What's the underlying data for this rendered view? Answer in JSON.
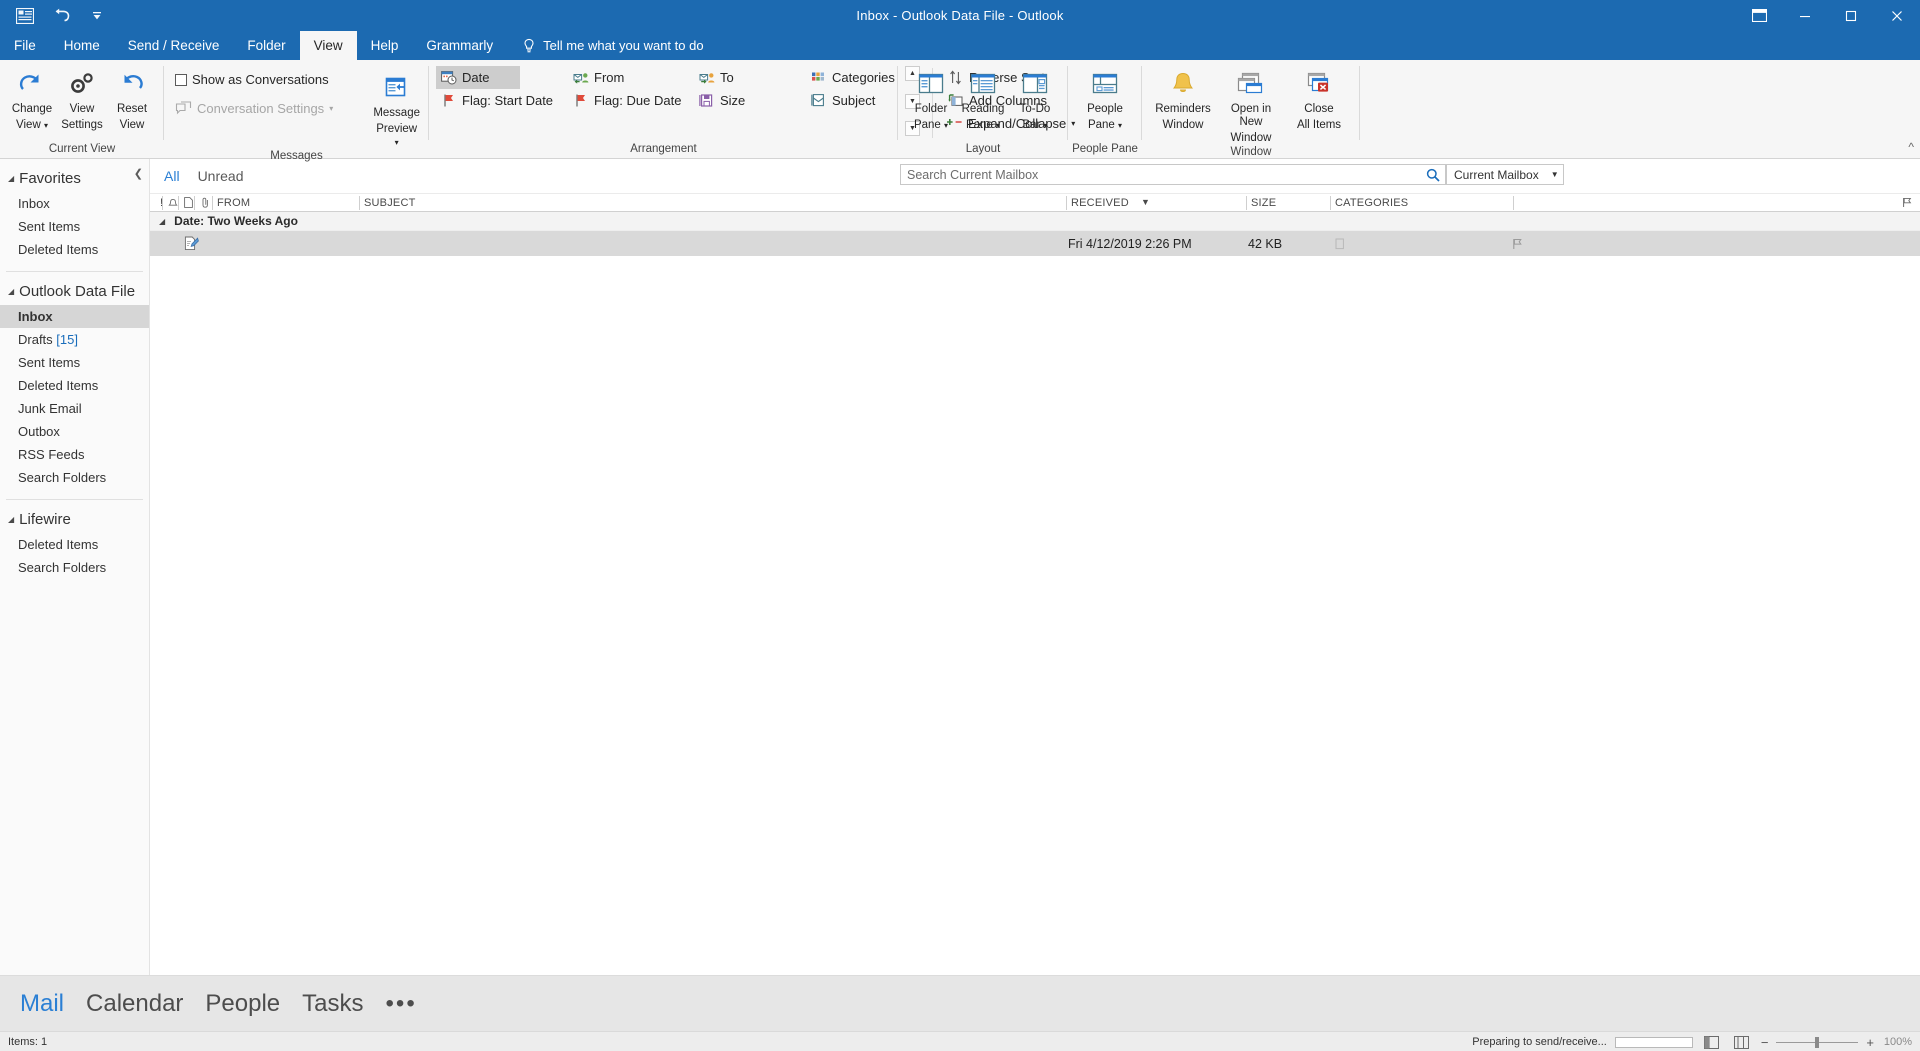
{
  "titlebar": {
    "title": "Inbox - Outlook Data File  -  Outlook",
    "qat": [
      {
        "name": "quick-access-app-icon",
        "glyph": "app"
      },
      {
        "name": "undo-icon",
        "glyph": "undo"
      },
      {
        "name": "customize-quick-access-toolbar-icon",
        "glyph": "caret"
      }
    ],
    "ribbon_display_options": "ribbon-display-options-icon",
    "minimize": "minimize-icon",
    "maximize": "maximize-icon",
    "close": "close-icon"
  },
  "tabs": [
    {
      "label": "File",
      "active": false
    },
    {
      "label": "Home",
      "active": false
    },
    {
      "label": "Send / Receive",
      "active": false
    },
    {
      "label": "Folder",
      "active": false
    },
    {
      "label": "View",
      "active": true
    },
    {
      "label": "Help",
      "active": false
    },
    {
      "label": "Grammarly",
      "active": false
    }
  ],
  "tell_me": "Tell me what you want to do",
  "ribbon": {
    "groups": [
      {
        "label": "Current View",
        "buttons": [
          {
            "label_line1": "Change",
            "label_line2": "View",
            "has_caret": true,
            "icon": "change-view-icon"
          },
          {
            "label_line1": "View",
            "label_line2": "Settings",
            "has_caret": false,
            "icon": "view-settings-icon"
          },
          {
            "label_line1": "Reset",
            "label_line2": "View",
            "has_caret": false,
            "icon": "reset-view-icon"
          }
        ]
      },
      {
        "label": "Messages",
        "checkbox_label": "Show as Conversations",
        "checkbox_checked": false,
        "conversation_settings_label": "Conversation Settings",
        "conversation_settings_disabled": true,
        "message_preview": {
          "label_line1": "Message",
          "label_line2": "Preview",
          "has_caret": true
        }
      },
      {
        "label": "Arrangement",
        "items": [
          {
            "label": "Date",
            "selected": true,
            "icon": "date-arrangement-icon"
          },
          {
            "label": "From",
            "selected": false,
            "icon": "from-arrangement-icon"
          },
          {
            "label": "To",
            "selected": false,
            "icon": "to-arrangement-icon"
          },
          {
            "label": "Categories",
            "selected": false,
            "icon": "categories-arrangement-icon"
          },
          {
            "label": "Flag: Start Date",
            "selected": false,
            "icon": "flag-start-date-icon"
          },
          {
            "label": "Flag: Due Date",
            "selected": false,
            "icon": "flag-due-date-icon"
          },
          {
            "label": "Size",
            "selected": false,
            "icon": "size-arrangement-icon"
          },
          {
            "label": "Subject",
            "selected": false,
            "icon": "subject-arrangement-icon"
          }
        ],
        "side_commands": [
          {
            "label": "Reverse Sort",
            "icon": "reverse-sort-icon",
            "has_caret": false
          },
          {
            "label": "Add Columns",
            "icon": "add-columns-icon",
            "has_caret": false
          },
          {
            "label": "Expand/Collapse",
            "icon": "expand-collapse-icon",
            "has_caret": true
          }
        ]
      },
      {
        "label": "Layout",
        "buttons": [
          {
            "label_line1": "Folder",
            "label_line2": "Pane",
            "has_caret": true,
            "icon": "folder-pane-icon"
          },
          {
            "label_line1": "Reading",
            "label_line2": "Pane",
            "has_caret": true,
            "icon": "reading-pane-icon"
          },
          {
            "label_line1": "To-Do",
            "label_line2": "Bar",
            "has_caret": true,
            "icon": "to-do-bar-icon"
          }
        ]
      },
      {
        "label": "People Pane",
        "buttons": [
          {
            "label_line1": "People",
            "label_line2": "Pane",
            "has_caret": true,
            "icon": "people-pane-icon"
          }
        ]
      },
      {
        "label": "Window",
        "buttons": [
          {
            "label_line1": "Reminders",
            "label_line2": "Window",
            "has_caret": false,
            "icon": "reminders-window-icon"
          },
          {
            "label_line1": "Open in New",
            "label_line2": "Window",
            "has_caret": false,
            "icon": "open-in-new-window-icon"
          },
          {
            "label_line1": "Close",
            "label_line2": "All Items",
            "has_caret": false,
            "icon": "close-all-items-icon"
          }
        ]
      }
    ]
  },
  "sidebar": {
    "collapse_icon": "collapse-folder-pane-icon",
    "sections": [
      {
        "title": "Favorites",
        "items": [
          {
            "label": "Inbox",
            "count": "",
            "active": false
          },
          {
            "label": "Sent Items",
            "count": "",
            "active": false
          },
          {
            "label": "Deleted Items",
            "count": "",
            "active": false
          }
        ]
      },
      {
        "title": "Outlook Data File",
        "items": [
          {
            "label": "Inbox",
            "count": "",
            "active": true
          },
          {
            "label": "Drafts",
            "count": "[15]",
            "active": false
          },
          {
            "label": "Sent Items",
            "count": "",
            "active": false
          },
          {
            "label": "Deleted Items",
            "count": "",
            "active": false
          },
          {
            "label": "Junk Email",
            "count": "",
            "active": false
          },
          {
            "label": "Outbox",
            "count": "",
            "active": false
          },
          {
            "label": "RSS Feeds",
            "count": "",
            "active": false
          },
          {
            "label": "Search Folders",
            "count": "",
            "active": false
          }
        ]
      },
      {
        "title": "Lifewire",
        "items": [
          {
            "label": "Deleted Items",
            "count": "",
            "active": false
          },
          {
            "label": "Search Folders",
            "count": "",
            "active": false
          }
        ]
      }
    ]
  },
  "filterbar": {
    "all": "All",
    "unread": "Unread"
  },
  "search": {
    "placeholder": "Search Current Mailbox",
    "value": "",
    "icon": "search-icon",
    "scope_label": "Current Mailbox",
    "scope_caret": "chevron-down-icon"
  },
  "message_list": {
    "columns": [
      {
        "key": "importance",
        "label": "!"
      },
      {
        "key": "reminder",
        "label": "reminder-icon"
      },
      {
        "key": "icon",
        "label": "item-icon"
      },
      {
        "key": "attachment",
        "label": "attachment-icon"
      },
      {
        "key": "from",
        "label": "FROM"
      },
      {
        "key": "subject",
        "label": "SUBJECT"
      },
      {
        "key": "received",
        "label": "RECEIVED"
      },
      {
        "key": "size",
        "label": "SIZE"
      },
      {
        "key": "categories",
        "label": "CATEGORIES"
      },
      {
        "key": "flag",
        "label": "flag-column-icon"
      }
    ],
    "sort_indicator": "sort-descending-icon",
    "groups": [
      {
        "header": "Date: Two Weeks Ago",
        "rows": [
          {
            "icon": "draft-message-icon",
            "from": "",
            "subject": "",
            "received": "Fri 4/12/2019 2:26 PM",
            "size": "42 KB",
            "categories": "",
            "flag": "flag-icon",
            "selected": true
          }
        ]
      }
    ]
  },
  "navbar": {
    "items": [
      {
        "label": "Mail",
        "active": true
      },
      {
        "label": "Calendar",
        "active": false
      },
      {
        "label": "People",
        "active": false
      },
      {
        "label": "Tasks",
        "active": false
      }
    ],
    "overflow": "•••"
  },
  "statusbar": {
    "items_count": "Items: 1",
    "progress_text": "Preparing to send/receive...",
    "normal_view_icon": "normal-view-icon",
    "reading_view_icon": "reading-view-icon",
    "zoom_out": "−",
    "zoom_in": "+",
    "zoom_level": "100%"
  },
  "colors": {
    "brand_blue": "#1c6ab1",
    "accent_link": "#2a7fd4",
    "selection_gray": "#d9d9d9"
  }
}
